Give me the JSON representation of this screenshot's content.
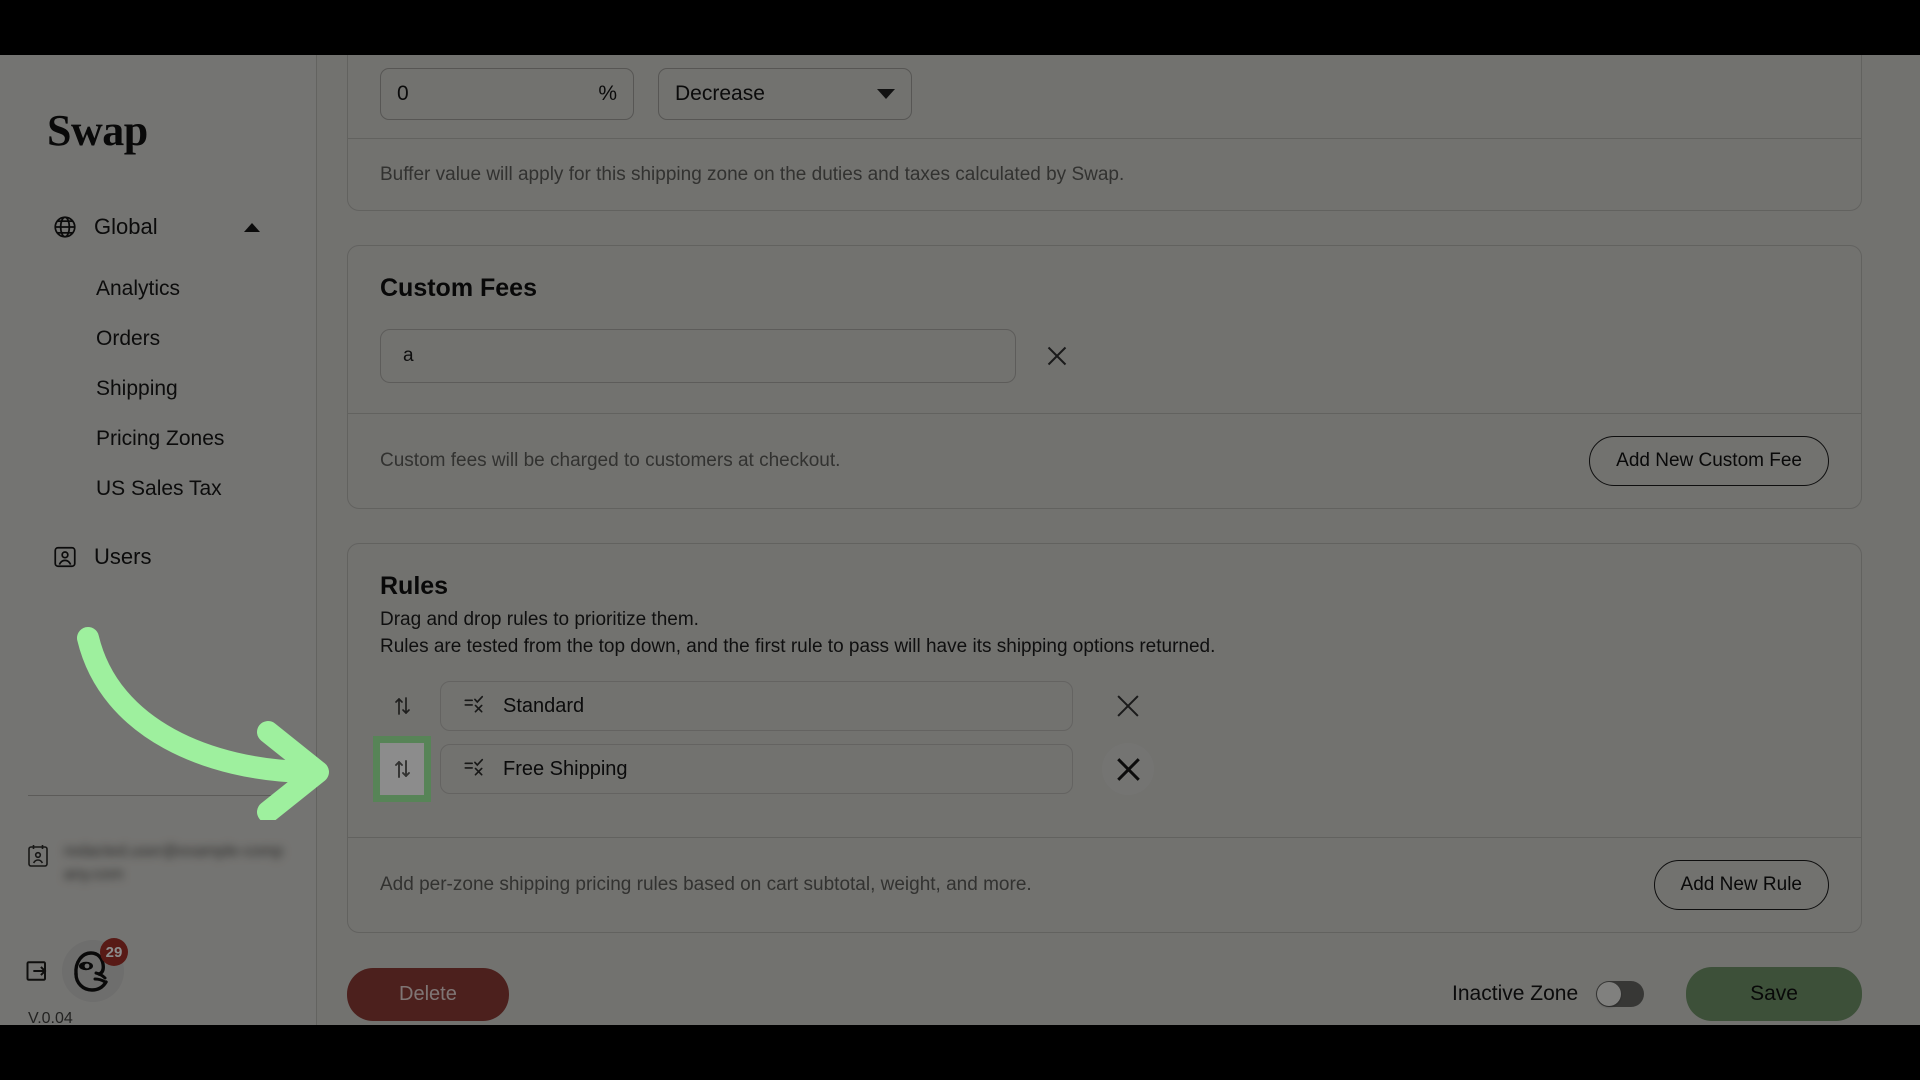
{
  "brand": {
    "name": "Swap"
  },
  "sidebar": {
    "group": {
      "label": "Global",
      "icon": "globe-icon",
      "expanded": true
    },
    "sub_items": [
      {
        "label": "Analytics"
      },
      {
        "label": "Orders"
      },
      {
        "label": "Shipping"
      },
      {
        "label": "Pricing Zones"
      },
      {
        "label": "US Sales Tax"
      }
    ],
    "items": [
      {
        "label": "Users",
        "icon": "user-card-icon"
      }
    ],
    "account": {
      "email": "redacted.user@example-company.com",
      "icon": "contact-card-icon"
    },
    "logout_icon": "logout-icon",
    "avatar_badge": "29",
    "version": "V.0.04"
  },
  "buffer_card": {
    "percent_value": "0",
    "percent_unit": "%",
    "direction_value": "Decrease",
    "note": "Buffer value will apply for this shipping zone on the duties and taxes calculated by Swap."
  },
  "custom_fees": {
    "title": "Custom Fees",
    "fee_value": "a",
    "remove_icon": "close-icon",
    "note": "Custom fees will be charged to customers at checkout.",
    "add_button": "Add New Custom Fee"
  },
  "rules": {
    "title": "Rules",
    "sub_line_1": "Drag and drop rules to prioritize them.",
    "sub_line_2": "Rules are tested from the top down, and the first rule to pass will have its shipping options returned.",
    "items": [
      {
        "label": "Standard",
        "handle_icon": "drag-updown-icon",
        "rule_icon": "rule-check-x-icon",
        "highlighted": false,
        "x_hover": false
      },
      {
        "label": "Free Shipping",
        "handle_icon": "drag-updown-icon",
        "rule_icon": "rule-check-x-icon",
        "highlighted": true,
        "x_hover": true
      }
    ],
    "note": "Add per-zone shipping pricing rules based on cart subtotal, weight, and more.",
    "add_button": "Add New Rule"
  },
  "actions": {
    "delete_label": "Delete",
    "toggle_label": "Inactive Zone",
    "toggle_on": false,
    "save_label": "Save"
  },
  "colors": {
    "accent_green": "#9ef09e",
    "save_green": "#6f9268",
    "delete_red": "#8a3b35",
    "badge_red": "#a03028",
    "page_bg": "#cfcfcb",
    "sidebar_bg": "#d4d3cf"
  }
}
